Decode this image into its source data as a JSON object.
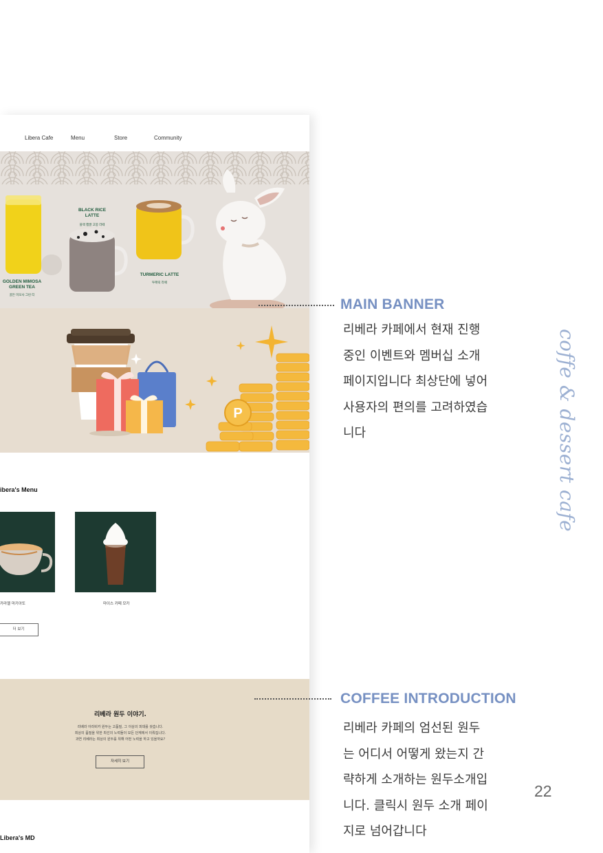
{
  "nav": {
    "items": [
      "Libera Cafe",
      "Menu",
      "Store",
      "Community"
    ]
  },
  "banner1": {
    "drinks": [
      {
        "name": "GOLDEN MIMOSA\nGREEN TEA",
        "sub": "골든 미모사 그린 티"
      },
      {
        "name": "BLACK RICE\nLATTE",
        "sub": "블랙 햅쌀 고봉 라떼"
      },
      {
        "name": "TURMERIC LATTE",
        "sub": "투메릭 라떼"
      }
    ]
  },
  "menu": {
    "title": "ibera's Menu",
    "items": [
      {
        "caption": "카라멜 마키아또"
      },
      {
        "caption": "마이스 카페 모카"
      }
    ],
    "more_label": "더 보기"
  },
  "story": {
    "title": "리베라 원두 이야기.",
    "body": "리베라 아라비카 원두는 고품질, 그 이상의 피데를 갖습니다.\n최상의 품질을 위한 최선의 노력들이 모든 단계에서 이뤄집니다.\n과연 리베라는 최상의 원두를 위해 어떤 노력을 하고 있을까요?",
    "button": "자세히 보기"
  },
  "md": {
    "title": "Libera's MD"
  },
  "annotations": {
    "main_banner": {
      "title": "MAIN BANNER",
      "desc": "리베라 카페에서 현재 진행\n중인 이벤트와 멤버십 소개\n페이지입니다 최상단에 넣어\n사용자의 편의를 고려하였습\n니다"
    },
    "coffee_intro": {
      "title": "COFFEE INTRODUCTION",
      "desc": "리베라 카페의 엄선된 원두\n는 어디서 어떻게 왔는지 간\n략하게 소개하는 원두소개입\n니다. 클릭시 원두 소개 페이\n지로 넘어갑니다"
    }
  },
  "side_text": "coffe & dessert cafe",
  "page_number": "22",
  "colors": {
    "accent": "#7690c2",
    "side": "#9cb0d2",
    "banner_green": "#1e5a3c",
    "card": "#1d3a31"
  }
}
